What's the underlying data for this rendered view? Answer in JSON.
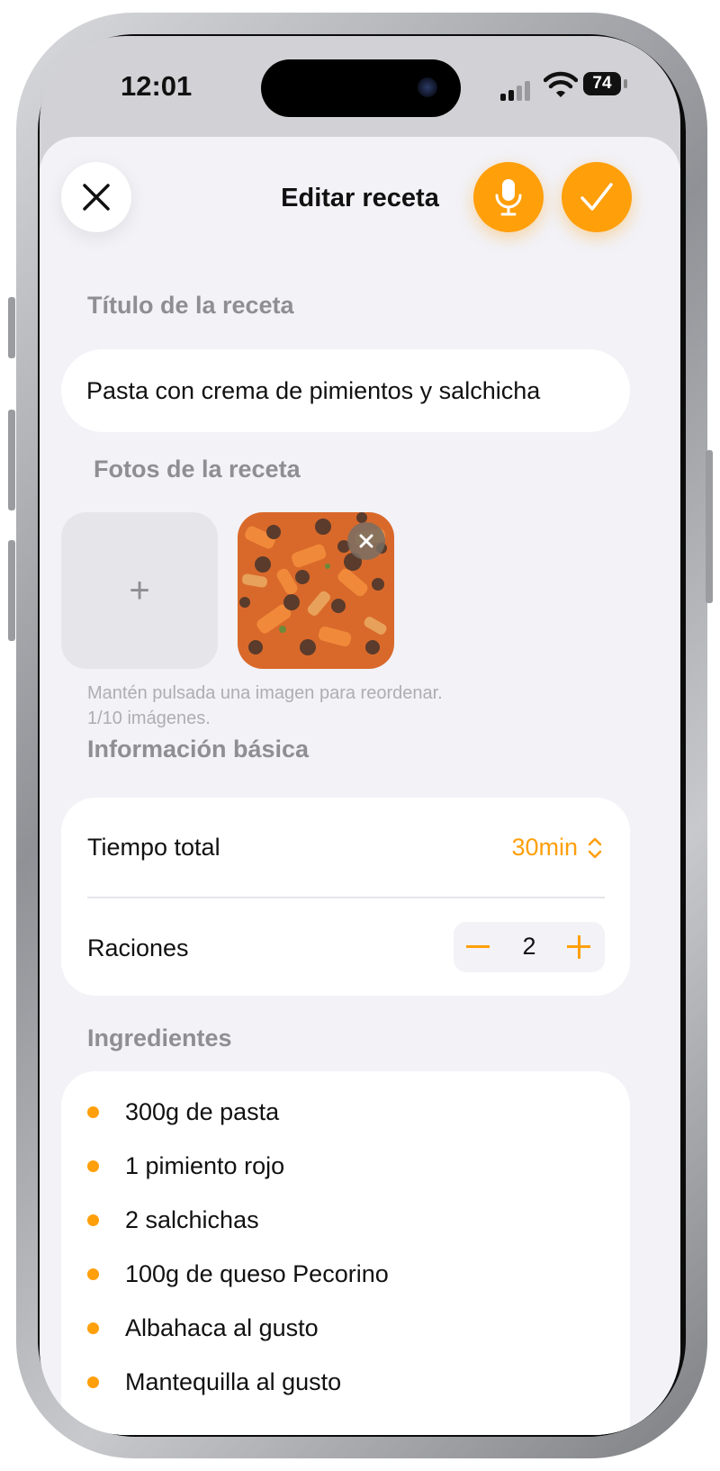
{
  "status_bar": {
    "time": "12:01",
    "battery": "74"
  },
  "nav": {
    "title": "Editar receta",
    "close_icon": "close-icon",
    "mic_icon": "microphone-icon",
    "check_icon": "checkmark-icon",
    "accent_color": "#ff9f0a"
  },
  "recipe_title": {
    "label": "Título de la receta",
    "value": "Pasta con crema de pimientos y salchicha"
  },
  "photos": {
    "label": "Fotos de la receta",
    "add_symbol": "+",
    "hint_line1": "Mantén pulsada una imagen para reordenar.",
    "hint_line2": "1/10 imágenes."
  },
  "basic_info": {
    "label": "Información básica",
    "total_time_label": "Tiempo total",
    "total_time_value": "30min",
    "servings_label": "Raciones",
    "servings_value": "2"
  },
  "ingredients": {
    "label": "Ingredientes",
    "items": [
      "300g de pasta",
      "1 pimiento rojo",
      "2 salchichas",
      "100g de queso Pecorino",
      "Albahaca al gusto",
      "Mantequilla al gusto"
    ]
  }
}
